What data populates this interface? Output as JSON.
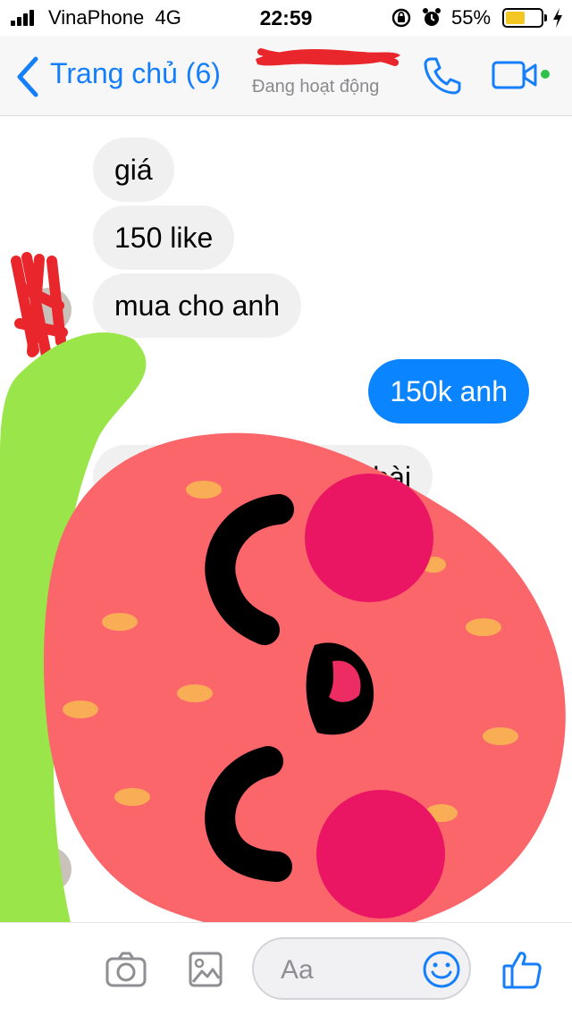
{
  "status_bar": {
    "carrier": "VinaPhone",
    "network": "4G",
    "time": "22:59",
    "battery_percent": "55%",
    "battery_level": 0.55,
    "battery_color": "#f4c623"
  },
  "header": {
    "back_label": "Trang chủ (6)",
    "contact_status": "Đang hoạt động",
    "icons": [
      "chevron-left-icon",
      "phone-icon",
      "video-camera-icon"
    ],
    "accent": "#147efb"
  },
  "messages": [
    {
      "side": "in",
      "text": "giá"
    },
    {
      "side": "in",
      "text": "150 like"
    },
    {
      "side": "in",
      "text": "mua cho anh"
    },
    {
      "side": "out",
      "text": "150k anh"
    },
    {
      "side": "in",
      "text": "bài"
    }
  ],
  "composer": {
    "placeholder": "Aa",
    "icons": [
      "camera-icon",
      "photo-icon",
      "emoji-icon",
      "thumbs-up-icon"
    ]
  },
  "colors": {
    "outgoing_bubble": "#0a84ff",
    "incoming_bubble": "#f0f0f0",
    "sticker_body": "#fb666b",
    "sticker_leaf": "#9ae64a"
  }
}
